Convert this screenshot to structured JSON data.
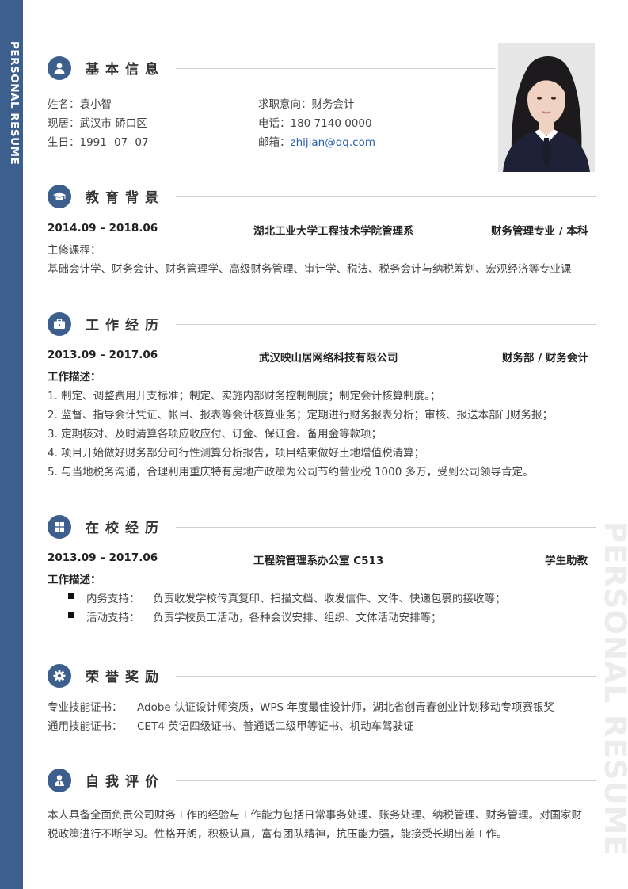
{
  "sidebar_label": "PERSONAL RESUME",
  "watermark": "PERSONAL RESUME",
  "colors": {
    "accent": "#3d5f8e",
    "link": "#2b5fb0",
    "text": "#444444"
  },
  "basic": {
    "title": "基本信息",
    "icon": "user-icon",
    "name": "姓名：袁小智",
    "residence": "现居：武汉市 硚口区",
    "birthday": "生日：1991- 07- 07",
    "intent": "求职意向：财务会计",
    "phone": "电话：180 7140 0000",
    "email_label": "邮箱：",
    "email": "zhijian@qq.com"
  },
  "education": {
    "title": "教育背景",
    "icon": "graduation-cap-icon",
    "period": "2014.09 – 2018.06",
    "school": "湖北工业大学工程技术学院管理系",
    "major": "财务管理专业 / 本科",
    "courses_label": "主修课程：",
    "courses": "基础会计学、财务会计、财务管理学、高级财务管理、审计学、税法、税务会计与纳税筹划、宏观经济等专业课"
  },
  "work": {
    "title": "工作经历",
    "icon": "briefcase-icon",
    "period": "2013.09 – 2017.06",
    "company": "武汉映山居网络科技有限公司",
    "position": "财务部 / 财务会计",
    "desc_label": "工作描述：",
    "items": [
      "1. 制定、调整费用开支标准；制定、实施内部财务控制制度；制定会计核算制度。；",
      "2. 监督、指导会计凭证、帐目、报表等会计核算业务；定期进行财务报表分析；审核、报送本部门财务报；",
      "3. 定期核对、及时清算各项应收应付、订金、保证金、备用金等款项；",
      "4. 项目开始做好财务部分可行性测算分析报告，项目结束做好土地增值税清算；",
      "5. 与当地税务沟通，合理利用重庆特有房地产政策为公司节约营业税 1000 多万，受到公司领导肯定。"
    ]
  },
  "campus": {
    "title": "在校经历",
    "icon": "windows-grid-icon",
    "period": "2013.09 – 2017.06",
    "org": "工程院管理系办公室 C513",
    "role": "学生助教",
    "desc_label": "工作描述：",
    "items": [
      {
        "label": "内务支持：",
        "text": "负责收发学校传真复印、扫描文档、收发信件、文件、快递包裹的接收等；"
      },
      {
        "label": "活动支持：",
        "text": "负责学校员工活动，各种会议安排、组织、文体活动安排等；"
      }
    ]
  },
  "honors": {
    "title": "荣誉奖励",
    "icon": "gear-icon",
    "items": [
      {
        "label": "专业技能证书：",
        "text": "Adobe 认证设计师资质，WPS 年度最佳设计师，湖北省创青春创业计划移动专项赛银奖"
      },
      {
        "label": "通用技能证书：",
        "text": "CET4 英语四级证书、普通话二级甲等证书、机动车驾驶证"
      }
    ]
  },
  "self": {
    "title": "自我评价",
    "icon": "person-icon",
    "line1": "本人具备全面负责公司财务工作的经验与工作能力包括日常事务处理、账务处理、纳税管理、财务管理。对国家财",
    "line2": "税政策进行不断学习。性格开朗，积极认真，富有团队精神，抗压能力强，能接受长期出差工作。"
  }
}
